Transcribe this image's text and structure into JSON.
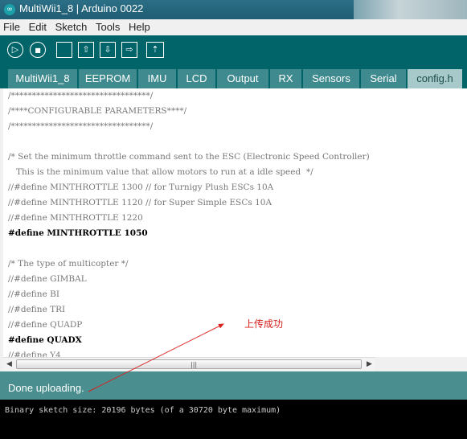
{
  "window": {
    "title": "MultiWii1_8 | Arduino 0022",
    "icon": "arduino-icon"
  },
  "menu": [
    "File",
    "Edit",
    "Sketch",
    "Tools",
    "Help"
  ],
  "toolbar": [
    {
      "icon": "play-icon",
      "glyph": "▷"
    },
    {
      "icon": "stop-icon",
      "glyph": "■"
    },
    {
      "icon": "new-file-icon",
      "glyph": ""
    },
    {
      "icon": "open-icon",
      "glyph": "⇧"
    },
    {
      "icon": "save-icon",
      "glyph": "⇩"
    },
    {
      "icon": "upload-icon",
      "glyph": "⇨"
    },
    {
      "icon": "serial-monitor-icon",
      "glyph": "⇡"
    }
  ],
  "tabs": [
    {
      "label": "MultiWii1_8",
      "active": false
    },
    {
      "label": "EEPROM",
      "active": false
    },
    {
      "label": "IMU",
      "active": false
    },
    {
      "label": "LCD",
      "active": false
    },
    {
      "label": "Output",
      "active": false
    },
    {
      "label": "RX",
      "active": false
    },
    {
      "label": "Sensors",
      "active": false
    },
    {
      "label": "Serial",
      "active": false
    },
    {
      "label": "config.h",
      "active": true
    }
  ],
  "code_lines": [
    {
      "text": "/*********************************/",
      "bold": false
    },
    {
      "text": "/****CONFIGURABLE PARAMETERS****/",
      "bold": false
    },
    {
      "text": "/*********************************/",
      "bold": false
    },
    {
      "text": "",
      "bold": false
    },
    {
      "text": "/* Set the minimum throttle command sent to the ESC (Electronic Speed Controller)",
      "bold": false
    },
    {
      "text": "   This is the minimum value that allow motors to run at a idle speed  */",
      "bold": false
    },
    {
      "text": "//#define MINTHROTTLE 1300 // for Turnigy Plush ESCs 10A",
      "bold": false
    },
    {
      "text": "//#define MINTHROTTLE 1120 // for Super Simple ESCs 10A",
      "bold": false
    },
    {
      "text": "//#define MINTHROTTLE 1220",
      "bold": false
    },
    {
      "text": "#define MINTHROTTLE 1050",
      "bold": true
    },
    {
      "text": "",
      "bold": false
    },
    {
      "text": "/* The type of multicopter */",
      "bold": false
    },
    {
      "text": "//#define GIMBAL",
      "bold": false
    },
    {
      "text": "//#define BI",
      "bold": false
    },
    {
      "text": "//#define TRI",
      "bold": false
    },
    {
      "text": "//#define QUADP",
      "bold": false
    },
    {
      "text": "#define QUADX",
      "bold": true
    },
    {
      "text": "//#define Y4",
      "bold": false
    }
  ],
  "status": {
    "message": "Done uploading."
  },
  "console": {
    "message": "Binary sketch size: 20196 bytes (of a 30720 byte maximum)"
  },
  "annotation": {
    "text": "上传成功",
    "color": "#d8201c"
  },
  "colors": {
    "toolbar": "#006468",
    "status": "#4a8e8f",
    "tab": "#3e8a8f",
    "tab_active": "#a7c9c9"
  }
}
